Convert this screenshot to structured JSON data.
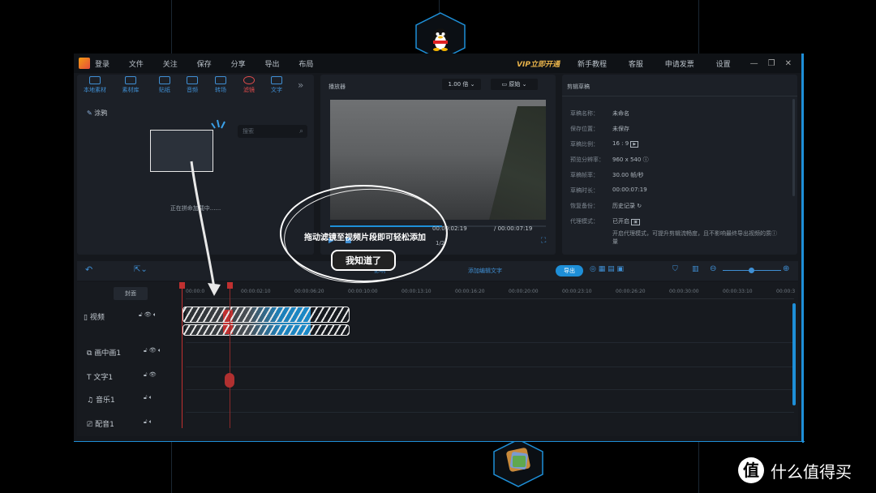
{
  "app": {
    "menu": [
      "登录",
      "文件",
      "关注",
      "保存",
      "分享",
      "导出",
      "布局"
    ],
    "vip_label": "VIP立即开通",
    "right_menu": [
      "新手教程",
      "客服",
      "申请发票",
      "设置"
    ],
    "window_controls": [
      "minimize-icon",
      "restore-icon",
      "close-icon"
    ]
  },
  "left_tabs": [
    {
      "label": "本地素材",
      "icon": "folder-icon"
    },
    {
      "label": "素材库",
      "icon": "library-icon"
    },
    {
      "label": "贴纸",
      "icon": "sticker-icon"
    },
    {
      "label": "音频",
      "icon": "music-icon"
    },
    {
      "label": "转场",
      "icon": "transition-icon"
    },
    {
      "label": "滤镜",
      "icon": "filter-icon",
      "active": true
    },
    {
      "label": "文字",
      "icon": "text-icon"
    }
  ],
  "left_panel": {
    "category": "涂鸦",
    "search_placeholder": "搜索",
    "loading_text": "正在拼命加载中......"
  },
  "player": {
    "title": "播放器",
    "speed": "1.00 倍",
    "ratio": "原始",
    "timecode": "00:00:02:19",
    "duration": "/ 00:00:07:19",
    "page": "1/2"
  },
  "draft": {
    "title": "剪辑草稿",
    "rows": [
      {
        "label": "草稿名称：",
        "value": "未命名"
      },
      {
        "label": "保存位置：",
        "value": "未保存"
      },
      {
        "label": "草稿比例：",
        "value": "16 : 9"
      },
      {
        "label": "预览分辨率：",
        "value": "960 x 540"
      },
      {
        "label": "草稿帧率：",
        "value": "30.00 帧/秒"
      },
      {
        "label": "草稿时长：",
        "value": "00:00:07:19"
      },
      {
        "label": "恢复备份：",
        "value": "历史记录"
      },
      {
        "label": "代理模式：",
        "value": "已开启"
      }
    ],
    "proxy_note": "开启代理模式，可提升剪辑流畅度，且不影响最终导出视频的质量"
  },
  "callout": {
    "text": "拖动滤镜至视频片段即可轻松添加",
    "button": "我知道了"
  },
  "timeline": {
    "export_label": "导出",
    "cover_label": "封面",
    "toolbar_hint_left": "影响",
    "toolbar_hint_right": "添加编辑文字",
    "ruler": [
      "00:00:0",
      "00:00:02:10",
      "00:00:06:20",
      "00:00:10:00",
      "00:00:13:10",
      "00:00:16:20",
      "00:00:20:00",
      "00:00:23:10",
      "00:00:26:20",
      "00:00:30:00",
      "00:00:33:10",
      "00:00:3"
    ],
    "tracks": [
      {
        "label": "视频",
        "sub": "视频"
      },
      {
        "label": "画中画1"
      },
      {
        "label": "文字1"
      },
      {
        "label": "音乐1"
      },
      {
        "label": "配音1"
      }
    ]
  },
  "watermark": "什么值得买",
  "colors": {
    "accent": "#1e8fd8",
    "active": "#e24c4c",
    "vip": "#e7b24a"
  }
}
